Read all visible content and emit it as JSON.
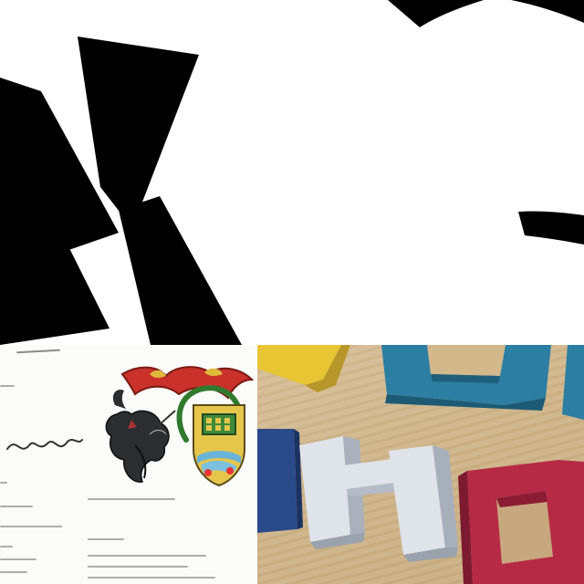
{
  "tiles": {
    "top": {
      "glyph_left": "K",
      "glyph_right": "S"
    },
    "document": {
      "crest": "crest-image"
    },
    "photo": {
      "letters": [
        "H",
        "O",
        "U",
        "O"
      ]
    }
  },
  "colors": {
    "glyph": "#000000",
    "letter_white": "#dfe3ea",
    "letter_blue": "#2c7fa3",
    "letter_red": "#b62a46",
    "letter_yellow": "#e7c533",
    "letter_navy": "#2a4a8a"
  }
}
